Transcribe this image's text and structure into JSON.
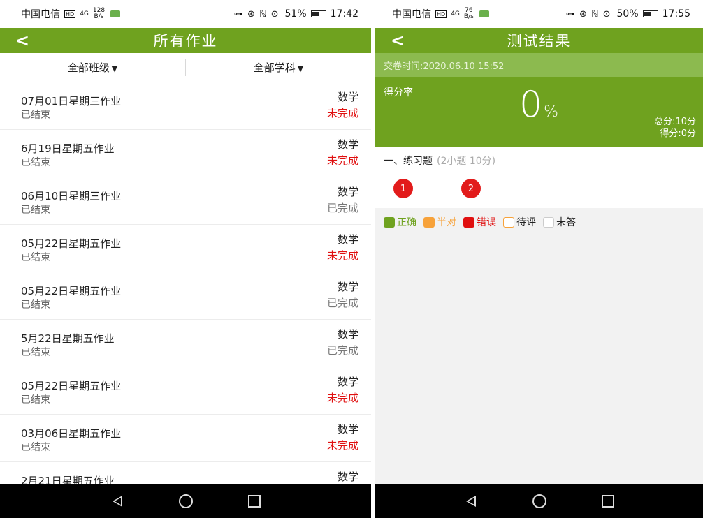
{
  "colors": {
    "brand_green": "#6fa21f",
    "light_green": "#8cba4f",
    "status_red": "#e01010",
    "status_gray": "#777777"
  },
  "left": {
    "status_bar": {
      "carrier": "中国电信",
      "hd_badge": "HD",
      "net": "4G",
      "speed_top": "128",
      "speed_bottom": "B/s",
      "icons": "⊶ ⊛ ℕ ⊙",
      "battery": "51%",
      "time": "17:42"
    },
    "header": {
      "back_icon": "chevron-left",
      "title": "所有作业"
    },
    "filters": [
      {
        "label": "全部班级"
      },
      {
        "label": "全部学科"
      }
    ],
    "homework": [
      {
        "name": "07月01日星期三作业",
        "state": "已结束",
        "subject": "数学",
        "status": "未完成",
        "tone": "red"
      },
      {
        "name": "6月19日星期五作业",
        "state": "已结束",
        "subject": "数学",
        "status": "未完成",
        "tone": "red"
      },
      {
        "name": "06月10日星期三作业",
        "state": "已结束",
        "subject": "数学",
        "status": "已完成",
        "tone": "gray"
      },
      {
        "name": "05月22日星期五作业",
        "state": "已结束",
        "subject": "数学",
        "status": "未完成",
        "tone": "red"
      },
      {
        "name": "05月22日星期五作业",
        "state": "已结束",
        "subject": "数学",
        "status": "已完成",
        "tone": "gray"
      },
      {
        "name": "5月22日星期五作业",
        "state": "已结束",
        "subject": "数学",
        "status": "已完成",
        "tone": "gray"
      },
      {
        "name": "05月22日星期五作业",
        "state": "已结束",
        "subject": "数学",
        "status": "未完成",
        "tone": "red"
      },
      {
        "name": "03月06日星期五作业",
        "state": "已结束",
        "subject": "数学",
        "status": "未完成",
        "tone": "red"
      },
      {
        "name": "2月21日星期五作业",
        "state": "",
        "subject": "数学",
        "status": "",
        "tone": "gray"
      }
    ]
  },
  "right": {
    "status_bar": {
      "carrier": "中国电信",
      "hd_badge": "HD",
      "net": "4G",
      "speed_top": "76",
      "speed_bottom": "B/s",
      "icons": "⊶ ⊛ ℕ ⊙",
      "battery": "50%",
      "time": "17:55"
    },
    "header": {
      "back_icon": "chevron-left",
      "title": "测试结果"
    },
    "submit_time": "交卷时间:2020.06.10 15:52",
    "score": {
      "label": "得分率",
      "percent_value": "0",
      "percent_unit": "%",
      "total": "总分:10分",
      "got": "得分:0分"
    },
    "section": {
      "title": "一、练习题",
      "meta": "(2小题 10分)",
      "questions": [
        "1",
        "2"
      ]
    },
    "legend": [
      {
        "label": "正确",
        "color": "#6fa21f",
        "text_color": "#6fa21f",
        "outlined": false
      },
      {
        "label": "半对",
        "color": "#f7a23a",
        "text_color": "#f7a23a",
        "outlined": false
      },
      {
        "label": "错误",
        "color": "#e01010",
        "text_color": "#e01010",
        "outlined": false
      },
      {
        "label": "待评",
        "color": "#f7a23a",
        "text_color": "#222222",
        "outlined": true
      },
      {
        "label": "未答",
        "color": "#cccccc",
        "text_color": "#222222",
        "outlined": true
      }
    ]
  }
}
